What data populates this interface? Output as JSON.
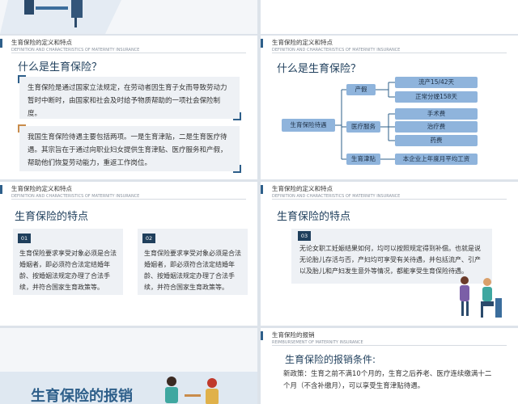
{
  "pagination": {
    "active_index": 0,
    "total": 6
  },
  "slide_header": {
    "def_cn": "生育保险的定义和特点",
    "def_en": "DEFINITION AND CHARACTERISTICS OF MATERNITY INSURANCE",
    "reimb_cn": "生育保险的报销",
    "reimb_en": "REIMBURSEMENT OF MATERNITY INSURANCE"
  },
  "slide_what": {
    "title": "什么是生育保险？",
    "para1": "生育保险是通过国家立法规定，在劳动者因生育子女而导致劳动力暂时中断时，由国家和社会及时给予物质帮助的一项社会保险制度。",
    "para2": "我国生育保险待遇主要包括两项。一是生育津贴，二是生育医疗待遇。其宗旨在于通过向职业妇女提供生育津贴、医疗服务和产假，帮助他们恢复劳动能力，重返工作岗位。"
  },
  "mindmap": {
    "title": "什么是生育保险？",
    "root": "生育保险待遇",
    "branches": [
      {
        "label": "产假",
        "leaves": [
          "流产15/42天",
          "正常分娩158天"
        ]
      },
      {
        "label": "医疗服务",
        "leaves": [
          "手术费",
          "治疗费",
          "药费"
        ]
      },
      {
        "label": "生育津贴",
        "leaves": [
          "本企业上年度月平均工资"
        ]
      }
    ]
  },
  "features_left": {
    "title": "生育保险的特点",
    "cards": [
      {
        "num": "01",
        "text": "生育保险要求享受对象必须是合法婚姻者，即必须符合法定结婚年龄、按婚姻法规定办理了合法手续，并符合国家生育政策等。"
      },
      {
        "num": "02",
        "text": "生育保险要求享受对象必须是合法婚姻者，即必须符合法定结婚年龄、按婚姻法规定办理了合法手续，并符合国家生育政策等。"
      }
    ]
  },
  "features_right": {
    "title": "生育保险的特点",
    "num": "03",
    "text": "无论女职工妊娠结果如何，均可以按照规定得到补偿。也就是说无论胎儿存活与否，产妇均可享受有关待遇，并包括流产、引产以及胎儿和产妇发生意外等情况，都能享受生育保险待遇。"
  },
  "reimb_section": {
    "title": "生育保险的报销"
  },
  "reimb_conditions": {
    "title": "生育保险的报销条件:",
    "text": "新政策：生育之前不满10个月的，生育之后养老、医疗连续缴满十二个月（不含补缴月），可以享受生育津贴待遇。"
  },
  "colors": {
    "primary": "#1f3f5c",
    "accent_blue": "#2e5f8a",
    "accent_orange": "#c98c4b",
    "node": "#8fb4dc"
  }
}
